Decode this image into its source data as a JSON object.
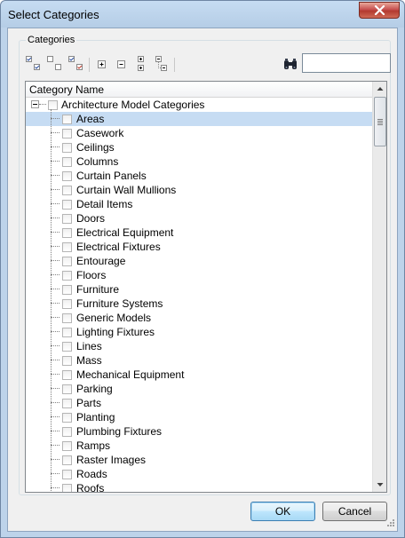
{
  "window": {
    "title": "Select Categories"
  },
  "group": {
    "label": "Categories"
  },
  "toolbar": {
    "buttons": [
      "check-all-icon",
      "uncheck-all-icon",
      "check-selected-icon",
      "expand-all-icon",
      "collapse-all-icon",
      "expand-level-icon",
      "collapse-level-icon"
    ],
    "find_icon": "binoculars-icon",
    "search_value": ""
  },
  "tree": {
    "column_header": "Category Name",
    "root_label": "Architecture Model Categories",
    "selected_item": "Areas",
    "items": [
      "Areas",
      "Casework",
      "Ceilings",
      "Columns",
      "Curtain Panels",
      "Curtain Wall Mullions",
      "Detail Items",
      "Doors",
      "Electrical Equipment",
      "Electrical Fixtures",
      "Entourage",
      "Floors",
      "Furniture",
      "Furniture Systems",
      "Generic Models",
      "Lighting Fixtures",
      "Lines",
      "Mass",
      "Mechanical Equipment",
      "Parking",
      "Parts",
      "Planting",
      "Plumbing Fixtures",
      "Ramps",
      "Raster Images",
      "Roads",
      "Roofs"
    ]
  },
  "footer": {
    "ok_label": "OK",
    "cancel_label": "Cancel"
  },
  "colors": {
    "selection": "#c6dcf3",
    "titlebar": "#bdd3ea",
    "close": "#c75050"
  }
}
